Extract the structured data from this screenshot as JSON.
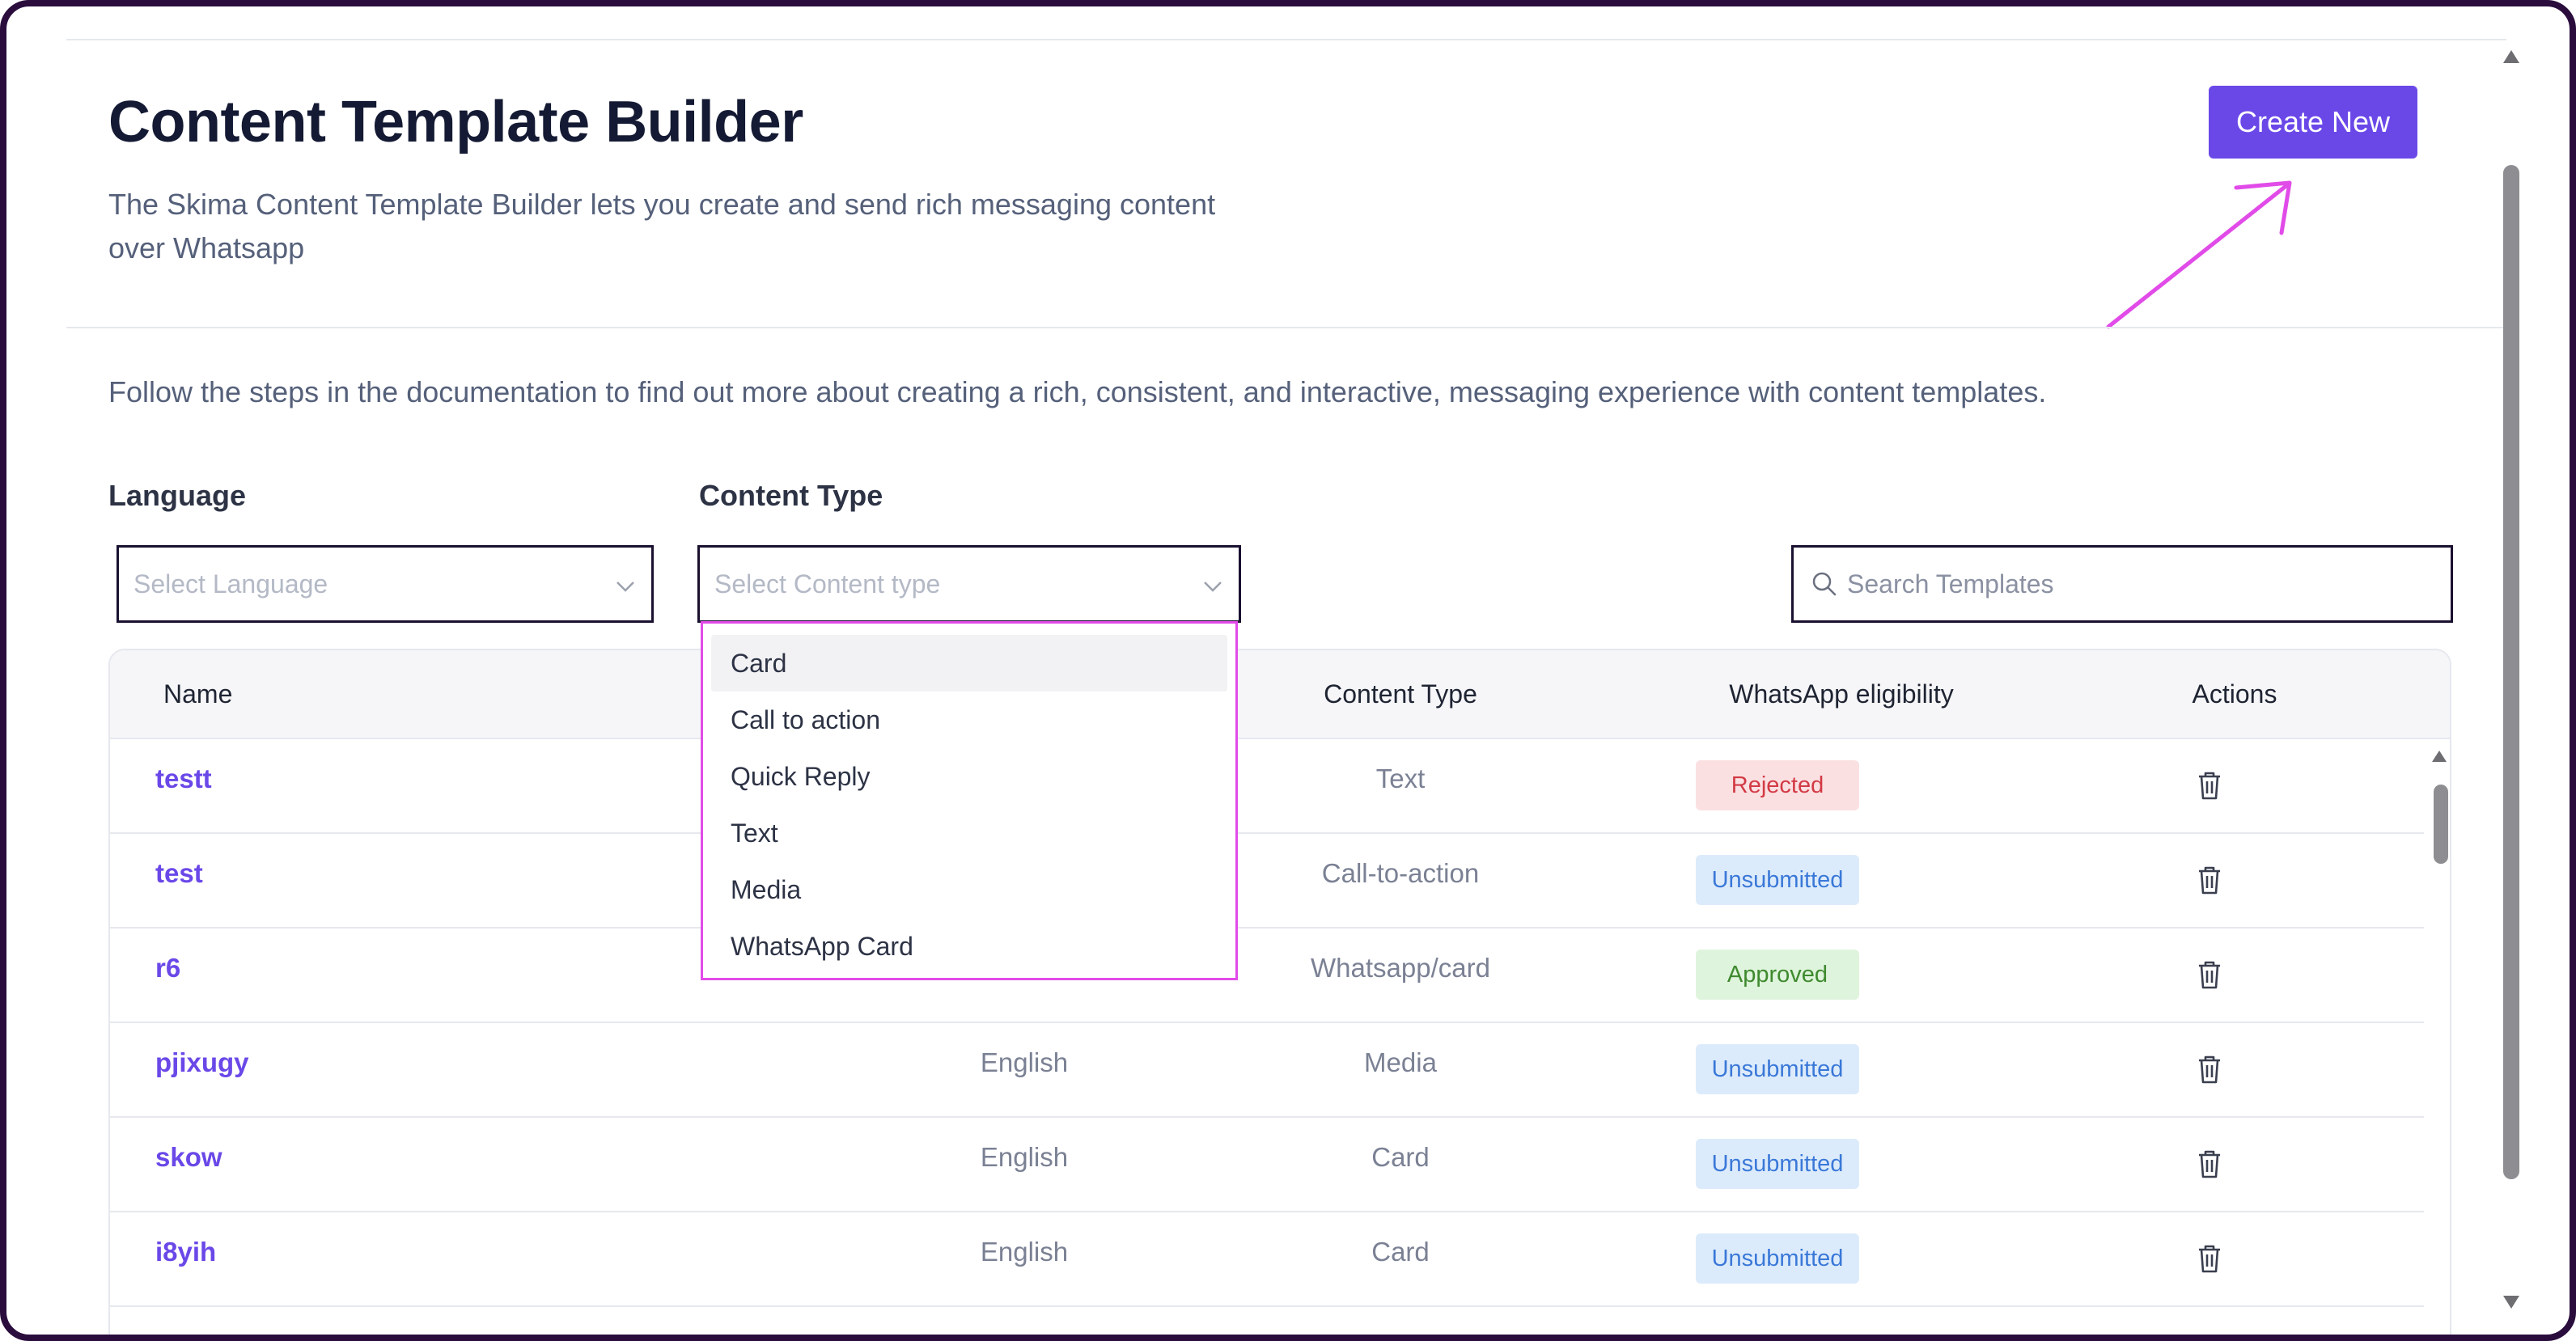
{
  "header": {
    "title": "Content Template Builder",
    "subtitle": "The Skima Content Template Builder lets you create and send rich messaging content over Whatsapp",
    "create_button": "Create New",
    "documentation_text": "Follow the steps in the documentation to find out more about creating a rich, consistent, and interactive, messaging experience with content templates."
  },
  "filters": {
    "language_label": "Language",
    "language_placeholder": "Select Language",
    "content_type_label": "Content Type",
    "content_type_placeholder": "Select Content type",
    "search_placeholder": "Search Templates"
  },
  "dropdown": {
    "options": [
      "Card",
      "Call to action",
      "Quick Reply",
      "Text",
      "Media",
      "WhatsApp Card"
    ],
    "highlighted": "Card"
  },
  "table": {
    "columns": {
      "name": "Name",
      "content_type": "Content Type",
      "whatsapp_eligibility": "WhatsApp eligibility",
      "actions": "Actions"
    },
    "rows": [
      {
        "name": "testt",
        "language": "",
        "content_type": "Text",
        "status": "Rejected"
      },
      {
        "name": "test",
        "language": "",
        "content_type": "Call-to-action",
        "status": "Unsubmitted"
      },
      {
        "name": "r6",
        "language": "",
        "content_type": "Whatsapp/card",
        "status": "Approved"
      },
      {
        "name": "pjixugy",
        "language": "English",
        "content_type": "Media",
        "status": "Unsubmitted"
      },
      {
        "name": "skow",
        "language": "English",
        "content_type": "Card",
        "status": "Unsubmitted"
      },
      {
        "name": "i8yih",
        "language": "English",
        "content_type": "Card",
        "status": "Unsubmitted"
      }
    ]
  },
  "icons": {
    "search": "search-icon",
    "chevron": "chevron-down-icon",
    "delete": "trash-icon"
  },
  "colors": {
    "accent": "#6a48e8",
    "annotation": "#e14be8",
    "rejected_bg": "#fbe0e2",
    "rejected_text": "#d23a44",
    "unsubmitted_bg": "#dcebfb",
    "unsubmitted_text": "#3a78d8",
    "approved_bg": "#dff4dc",
    "approved_text": "#3f8a2f"
  }
}
